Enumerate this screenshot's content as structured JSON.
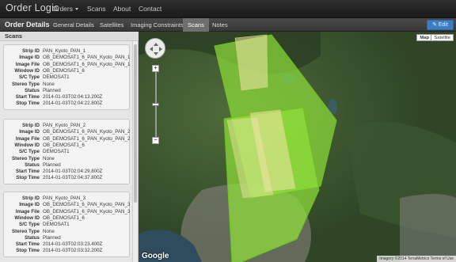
{
  "navbar": {
    "brand": "Order Logic",
    "items": [
      {
        "label": "Orders"
      },
      {
        "label": "Scans"
      },
      {
        "label": "About"
      },
      {
        "label": "Contact"
      }
    ]
  },
  "subnav": {
    "title": "Order Details",
    "tabs": [
      {
        "label": "General Details"
      },
      {
        "label": "Satellites"
      },
      {
        "label": "Imaging Constraints"
      },
      {
        "label": "Scans"
      },
      {
        "label": "Notes"
      }
    ],
    "active_tab": "Scans",
    "edit_label": "✎ Edit"
  },
  "panel": {
    "title": "Scans",
    "field_labels": [
      "Strip ID",
      "Image ID",
      "Image File",
      "Window ID",
      "S/C Type",
      "Stereo Type",
      "Status",
      "Start Time",
      "Stop Time"
    ],
    "scans": [
      {
        "strip_id": "PAN_Kyoto_PAN_1",
        "image_id": "OB_DEMOSAT1_6_PAN_Kyoto_PAN_1_0",
        "image_file": "OB_DEMOSAT1_6_PAN_Kyoto_PAN_1_0.j",
        "window_id": "OB_DEMOSAT1_6",
        "sc_type": "DEMOSAT1",
        "stereo_type": "None",
        "status": "Planned",
        "start_time": "2014-01-03T02:04:13.200Z",
        "stop_time": "2014-01-03T02:04:22.800Z"
      },
      {
        "strip_id": "PAN_Kyoto_PAN_2",
        "image_id": "OB_DEMOSAT1_6_PAN_Kyoto_PAN_2_0",
        "image_file": "OB_DEMOSAT1_6_PAN_Kyoto_PAN_2_0.j",
        "window_id": "OB_DEMOSAT1_6",
        "sc_type": "DEMOSAT1",
        "stereo_type": "None",
        "status": "Planned",
        "start_time": "2014-01-03T02:04:29.800Z",
        "stop_time": "2014-01-03T02:04:37.800Z"
      },
      {
        "strip_id": "PAN_Kyoto_PAN_3",
        "image_id": "OB_DEMOSAT1_6_PAN_Kyoto_PAN_3_0",
        "image_file": "OB_DEMOSAT1_6_PAN_Kyoto_PAN_3_0.j",
        "window_id": "OB_DEMOSAT1_6",
        "sc_type": "DEMOSAT1",
        "stereo_type": "None",
        "status": "Planned",
        "start_time": "2014-01-03T02:03:23.400Z",
        "stop_time": "2014-01-03T02:03:32.200Z"
      }
    ]
  },
  "map": {
    "type_buttons": [
      {
        "label": "Map"
      },
      {
        "label": "Satellite"
      }
    ],
    "selected_type": "Satellite",
    "zoom_in": "+",
    "zoom_out": "−",
    "logo": "Google",
    "attribution": "Imagery ©2014 TerraMetrics   Terms of Use",
    "colors": {
      "footprint_fill": "#8fe03a",
      "footprint_stroke": "#6cc21e",
      "strip_fill": "#f2e8a8"
    }
  }
}
